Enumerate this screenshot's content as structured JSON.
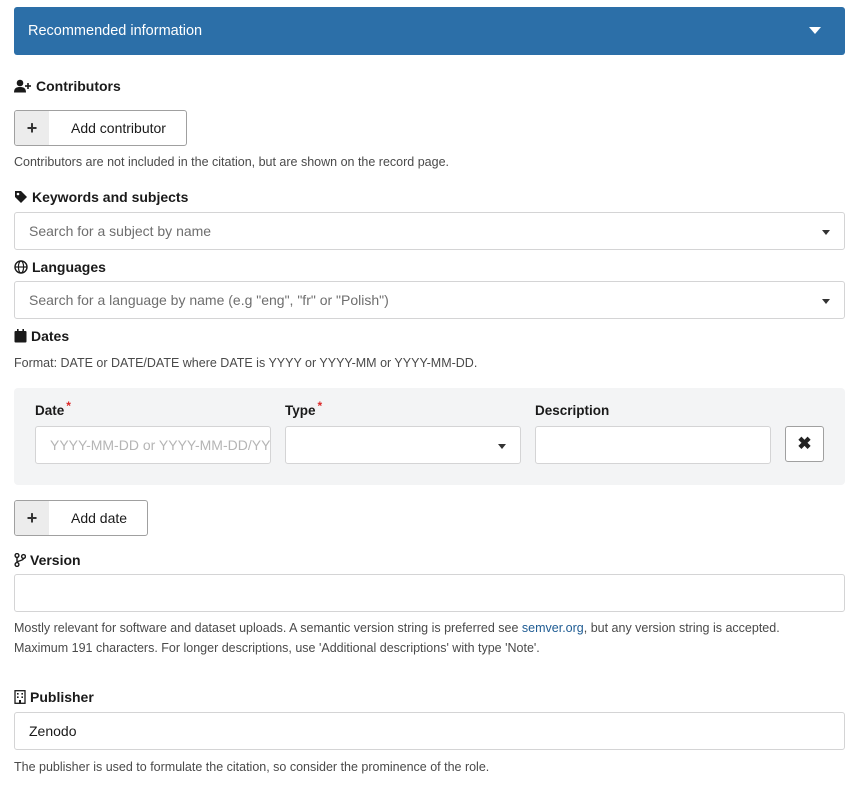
{
  "accordion": {
    "title": "Recommended information"
  },
  "contributors": {
    "label": "Contributors",
    "add_button": "Add contributor",
    "help": "Contributors are not included in the citation, but are shown on the record page."
  },
  "keywords": {
    "label": "Keywords and subjects",
    "placeholder": "Search for a subject by name"
  },
  "languages": {
    "label": "Languages",
    "placeholder": "Search for a language by name (e.g \"eng\", \"fr\" or \"Polish\")"
  },
  "dates": {
    "label": "Dates",
    "help": "Format: DATE or DATE/DATE where DATE is YYYY or YYYY-MM or YYYY-MM-DD.",
    "date_label": "Date",
    "type_label": "Type",
    "description_label": "Description",
    "required_mark": "*",
    "date_placeholder": "YYYY-MM-DD or YYYY-MM-DD/YYYY-MM-DD",
    "remove_symbol": "✖",
    "add_button": "Add date"
  },
  "version": {
    "label": "Version",
    "help_pre": "Mostly relevant for software and dataset uploads. A semantic version string is preferred see ",
    "help_link": "semver.org",
    "help_post": ", but any version string is accepted.",
    "help_line2": "Maximum 191 characters. For longer descriptions, use 'Additional descriptions' with type 'Note'."
  },
  "publisher": {
    "label": "Publisher",
    "value": "Zenodo",
    "help": "The publisher is used to formulate the citation, so consider the prominence of the role."
  },
  "colors": {
    "header_bg": "#2c6fa8",
    "link": "#1f5c93",
    "required": "#db2828"
  }
}
